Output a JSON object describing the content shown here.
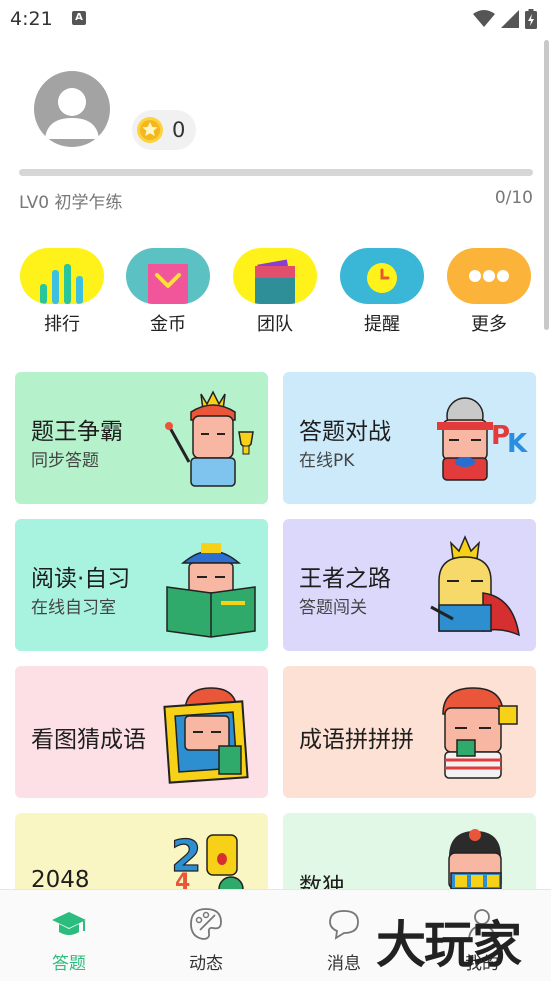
{
  "status_bar": {
    "time": "4:21",
    "notif_icon": "A"
  },
  "profile": {
    "coins": "0",
    "level_label": "LV0 初学乍练",
    "level_progress": "0/10",
    "progress_fraction": 0.0
  },
  "quick_actions": [
    {
      "label": "排行",
      "icon": "bar-chart-icon",
      "color": "#fff21a"
    },
    {
      "label": "金币",
      "icon": "coin-box-icon",
      "color": "#5bc1c3"
    },
    {
      "label": "团队",
      "icon": "team-flag-icon",
      "color": "#fff21a"
    },
    {
      "label": "提醒",
      "icon": "clock-icon",
      "color": "#3ab7d6"
    },
    {
      "label": "更多",
      "icon": "more-dots-icon",
      "color": "#fbb33a"
    }
  ],
  "cards": [
    {
      "title": "题王争霸",
      "subtitle": "同步答题",
      "bg": "#b5f2cc"
    },
    {
      "title": "答题对战",
      "subtitle": "在线PK",
      "bg": "#cdeafb"
    },
    {
      "title": "阅读·自习",
      "subtitle": "在线自习室",
      "bg": "#a8f3e0"
    },
    {
      "title": "王者之路",
      "subtitle": "答题闯关",
      "bg": "#dcd8fb"
    },
    {
      "title": "看图猜成语",
      "subtitle": "",
      "bg": "#fde0e6"
    },
    {
      "title": "成语拼拼拼",
      "subtitle": "",
      "bg": "#fde1d4"
    },
    {
      "title": "2048",
      "subtitle": "",
      "bg": "#faf6c4"
    },
    {
      "title": "数独",
      "subtitle": "",
      "bg": "#e2f8e6"
    }
  ],
  "bottom_nav": [
    {
      "label": "答题",
      "active": true
    },
    {
      "label": "动态",
      "active": false
    },
    {
      "label": "消息",
      "active": false
    },
    {
      "label": "我的",
      "active": false
    }
  ],
  "watermark": "大玩家",
  "colors": {
    "accent": "#2bbd7e",
    "progress_track": "#d6d6d6"
  }
}
